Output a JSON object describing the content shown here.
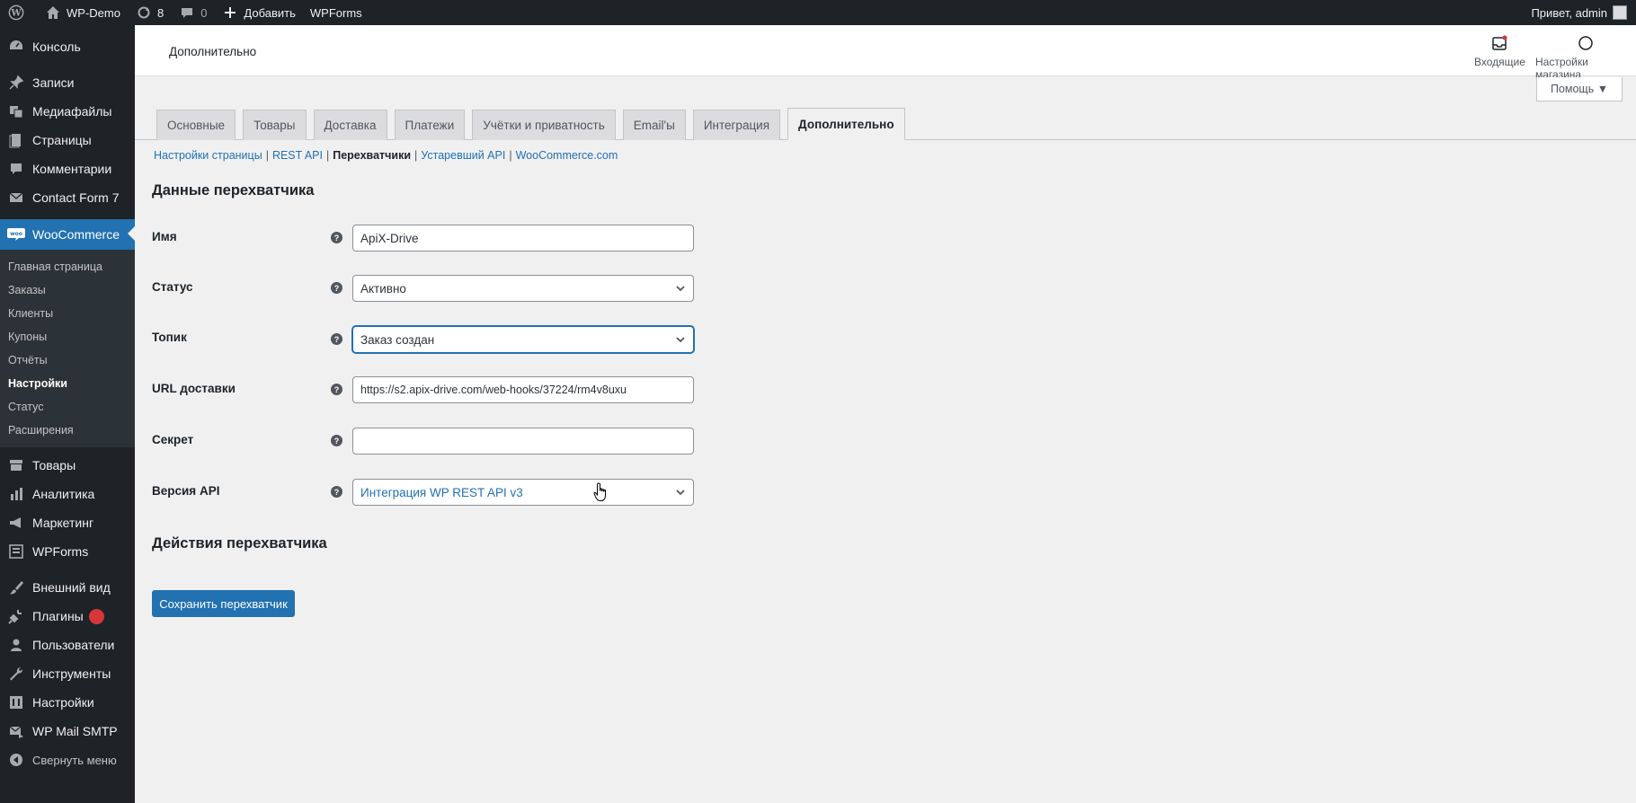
{
  "adminbar": {
    "site_name": "WP-Demo",
    "updates_count": "8",
    "comments_count": "0",
    "add_new": "Добавить",
    "wpforms": "WPForms",
    "greeting": "Привет, admin"
  },
  "sidebar": {
    "top_items": [
      {
        "label": "Консоль",
        "icon": "dashboard-icon"
      },
      {
        "label": "Записи",
        "icon": "pin-icon"
      },
      {
        "label": "Медиафайлы",
        "icon": "media-icon"
      },
      {
        "label": "Страницы",
        "icon": "page-icon"
      },
      {
        "label": "Комментарии",
        "icon": "comment-icon"
      },
      {
        "label": "Contact Form 7",
        "icon": "mail-icon"
      }
    ],
    "woocommerce": {
      "label": "WooCommerce",
      "icon": "woo-icon"
    },
    "woo_submenu": [
      "Главная страница",
      "Заказы",
      "Клиенты",
      "Купоны",
      "Отчёты",
      "Настройки",
      "Статус",
      "Расширения"
    ],
    "woo_current": "Настройки",
    "bottom_items": [
      {
        "label": "Товары",
        "icon": "archive-icon"
      },
      {
        "label": "Аналитика",
        "icon": "chart-icon"
      },
      {
        "label": "Маркетинг",
        "icon": "megaphone-icon"
      },
      {
        "label": "WPForms",
        "icon": "form-icon"
      },
      {
        "label": "Внешний вид",
        "icon": "brush-icon"
      },
      {
        "label": "Плагины",
        "icon": "plugin-icon"
      },
      {
        "label": "Пользователи",
        "icon": "user-icon"
      },
      {
        "label": "Инструменты",
        "icon": "wrench-icon"
      },
      {
        "label": "Настройки",
        "icon": "settings-icon"
      },
      {
        "label": "WP Mail SMTP",
        "icon": "mail-send-icon"
      },
      {
        "label": "Свернуть меню",
        "icon": "collapse-icon"
      }
    ]
  },
  "header": {
    "title": "Дополнительно",
    "inbox": "Входящие",
    "store_settings": "Настройки магазина"
  },
  "help_button": "Помощь ▼",
  "tabs": [
    "Основные",
    "Товары",
    "Доставка",
    "Платежи",
    "Учётки и приватность",
    "Email'ы",
    "Интеграция",
    "Дополнительно"
  ],
  "active_tab": "Дополнительно",
  "subnav": {
    "items": [
      "Настройки страницы",
      "REST API",
      "Перехватчики",
      "Устаревший API",
      "WooCommerce.com"
    ],
    "current": "Перехватчики"
  },
  "sections": {
    "data_title": "Данные перехватчика",
    "actions_title": "Действия перехватчика"
  },
  "form": {
    "name_label": "Имя",
    "name_value": "ApiX-Drive",
    "status_label": "Статус",
    "status_value": "Активно",
    "topic_label": "Топик",
    "topic_value": "Заказ создан",
    "url_label": "URL доставки",
    "url_value": "https://s2.apix-drive.com/web-hooks/37224/rm4v8uxu",
    "secret_label": "Секрет",
    "secret_value": "",
    "api_label": "Версия API",
    "api_value": "Интеграция WP REST API v3",
    "help_glyph": "?"
  },
  "save_button": "Сохранить перехватчик",
  "colors": {
    "primary": "#2271b1",
    "sidebar": "#1d2327",
    "background": "#f0f0f1"
  }
}
